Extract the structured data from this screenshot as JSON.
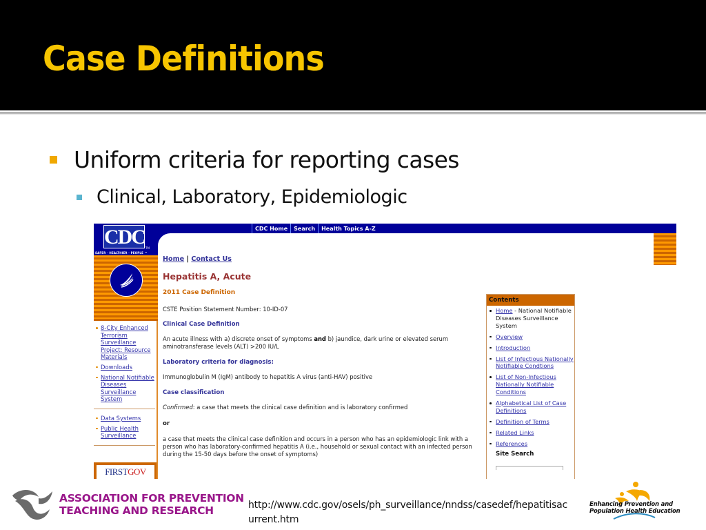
{
  "slide": {
    "title": "Case Definitions",
    "bullets": [
      {
        "text": "Uniform criteria for reporting cases",
        "level": 1,
        "marker_color": "#f0a800"
      },
      {
        "text": "Clinical, Laboratory, Epidemiologic",
        "level": 2,
        "marker_color": "#5ab4cf"
      }
    ],
    "title_color": "#f7c500"
  },
  "cdc_page": {
    "logo_text": "CDC",
    "logo_tm": "TM",
    "tagline": "SAFER · HEALTHIER · PEOPLE ™",
    "top_nav": [
      "CDC Home",
      "Search",
      "Health Topics A-Z"
    ],
    "breadcrumb": {
      "home": "Home",
      "separator": "|",
      "contact": "Contact Us"
    },
    "heading": "Hepatitis A, Acute",
    "subheading": "2011 Case Definition",
    "cste": "CSTE Position Statement Number: 10-ID-07",
    "sections": {
      "clinical_title": "Clinical Case Definition",
      "clinical_pre": "An acute illness with a) discrete onset of symptoms ",
      "clinical_bold": "and",
      "clinical_post": " b) jaundice, dark urine or elevated serum aminotransferase levels (ALT) >200 IU/L",
      "lab_title": "Laboratory criteria for diagnosis:",
      "lab_text": "Immunoglobulin M (IgM) antibody to hepatitis A virus (anti-HAV) positive",
      "class_title": "Case classification",
      "confirmed_label": "Confirmed",
      "confirmed_text": ": a case that meets the clinical case definition and is laboratory confirmed",
      "or": "or",
      "epi_text": "a case that meets the clinical case definition and occurs in a person who has an epidemiologic link with a person who has laboratory-confirmed hepatitis A (i.e., household or sexual contact with an infected person during the 15-50 days before the onset of symptoms)"
    },
    "left_nav": {
      "group1": [
        "8-City Enhanced Terrorism Surveillance Project: Resource Materials",
        "Downloads",
        "National Notifiable Diseases Surveillance System"
      ],
      "group2": [
        "Data Systems",
        "Public Health Surveillance"
      ],
      "firstgov_first": "FIRST",
      "firstgov_gov": "GOV"
    },
    "contents": {
      "title": "Contents",
      "home_link": "Home",
      "home_suffix": " - National Notifiable Diseases Surveillance System",
      "items": [
        "Overview",
        "Introduction",
        "List of Infectious Nationally Notifiable Condtions",
        "List of Non-Infectious Nationally Notifiable Conditions",
        "Alphabetical List of Case Definitions",
        "Definition of Terms",
        "Related Links",
        "References"
      ],
      "site_search": "Site Search"
    }
  },
  "footer": {
    "aptr_line1": "ASSOCIATION FOR PREVENTION",
    "aptr_line2": "TEACHING AND RESEARCH",
    "url": "http://www.cdc.gov/osels/ph_surveillance/nndss/casedef/hepatitisacurrent.htm",
    "ephe_line1": "Enhancing Prevention and",
    "ephe_line2": "Population Health Education"
  }
}
